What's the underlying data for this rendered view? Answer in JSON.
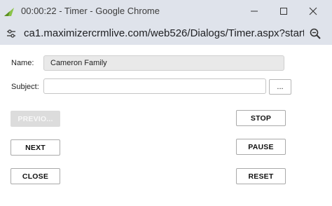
{
  "window": {
    "title": "00:00:22 - Timer - Google Chrome",
    "icon": "maximizer-app-icon",
    "brand_color": "#8bc34a"
  },
  "address_bar": {
    "url": "ca1.maximizercrmlive.com/web526/Dialogs/Timer.aspx?startTim..."
  },
  "form": {
    "name_label": "Name:",
    "name_value": "Cameron Family",
    "subject_label": "Subject:",
    "subject_value": "",
    "ellipsis_label": "..."
  },
  "buttons": {
    "previous": "PREVIO...",
    "next": "NEXT",
    "close": "CLOSE",
    "stop": "STOP",
    "pause": "PAUSE",
    "reset": "RESET"
  }
}
